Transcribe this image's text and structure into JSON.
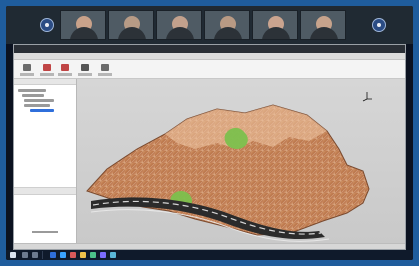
{
  "frame": {
    "outer_color": "#1f5d9d"
  },
  "video_call": {
    "participant_tiles": 6,
    "nav_left_icon": "chevron-left-icon",
    "nav_right_icon": "chevron-right-icon"
  },
  "app": {
    "titlebar_title": "",
    "ribbon_tabs": [
      "",
      "",
      ""
    ],
    "toolbar_buttons": [
      {
        "name": "open",
        "icon": "folder-icon",
        "color": "#6b6b6b"
      },
      {
        "name": "import",
        "icon": "import-icon",
        "color": "#c04545"
      },
      {
        "name": "export",
        "icon": "export-icon",
        "color": "#c04545"
      },
      {
        "name": "tools",
        "icon": "tools-icon",
        "color": "#555555"
      },
      {
        "name": "settings",
        "icon": "settings-icon",
        "color": "#6b6b6b"
      }
    ],
    "left_panel": {
      "tree_items": [
        "",
        "",
        "",
        "",
        ""
      ],
      "selected_index": 4
    },
    "viewport": {
      "background": "#cfcfcf",
      "terrain_color": "#c07a4e",
      "vegetation_color": "#7cc04d",
      "road_color": "#2b2b2b"
    },
    "statusbar_text": ""
  },
  "taskbar": {
    "time": "",
    "accent": "#2f6fdb"
  }
}
